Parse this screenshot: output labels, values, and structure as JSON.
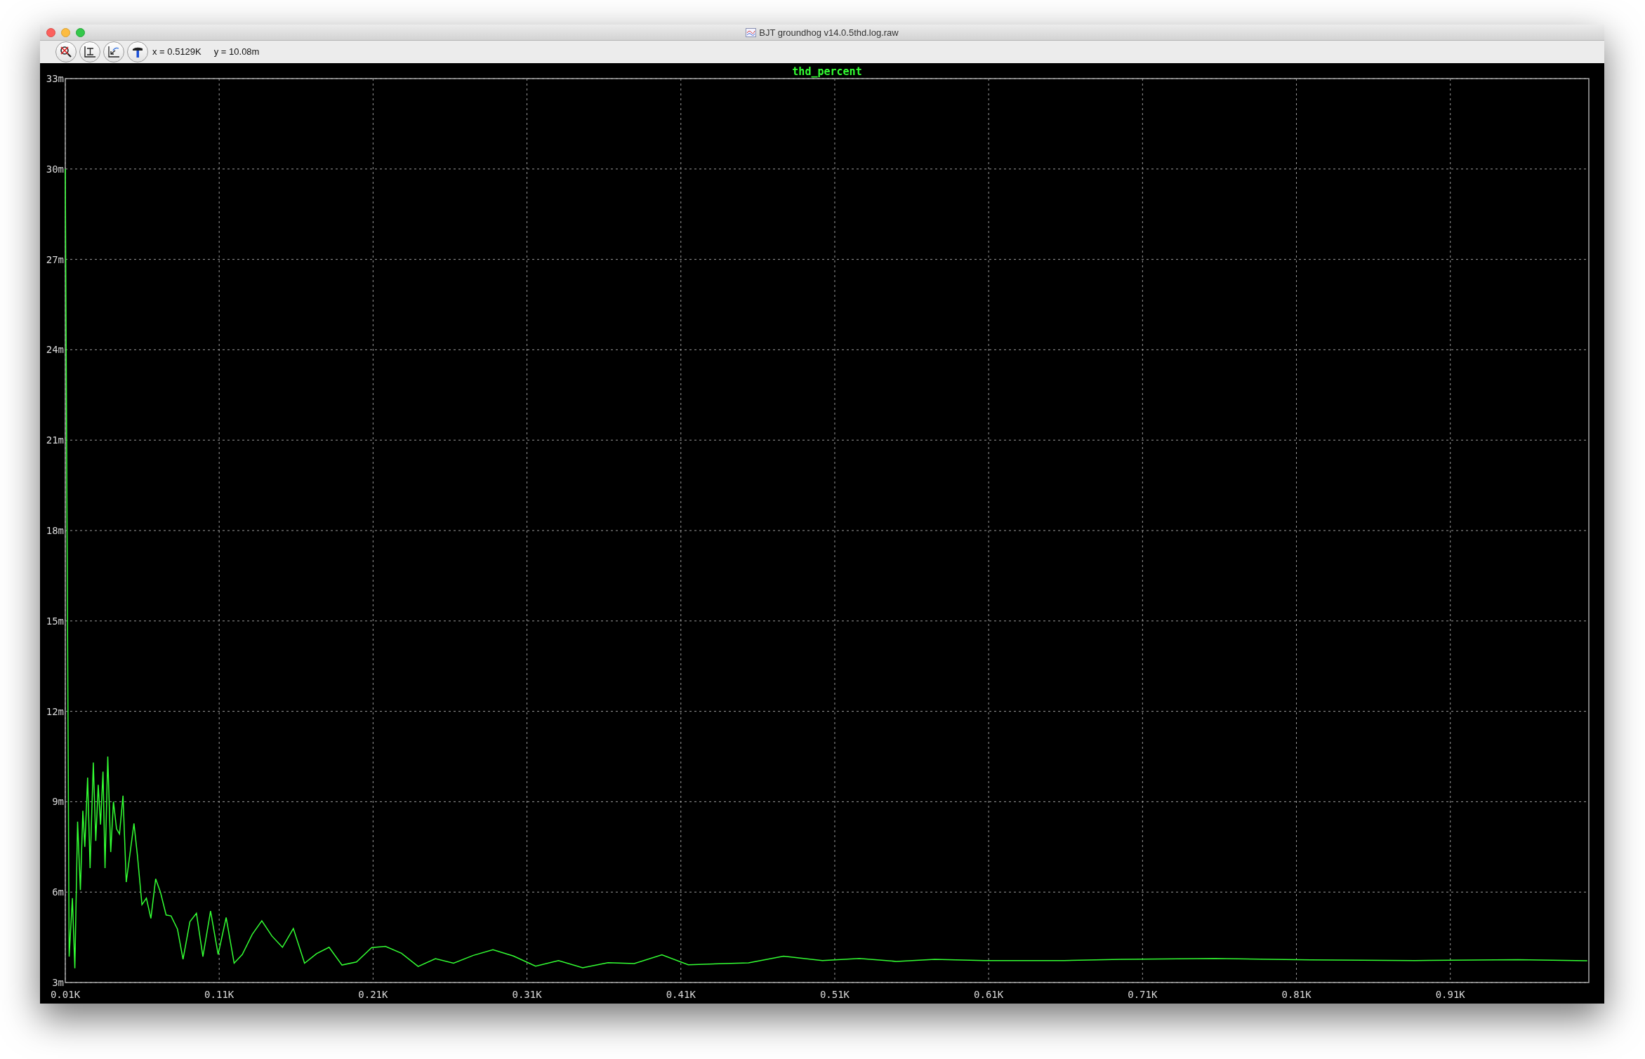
{
  "window": {
    "title": "BJT groundhog v14.0.5thd.log.raw"
  },
  "toolbar": {
    "cursor_x": "x = 0.5129K",
    "cursor_y": "y = 10.08m"
  },
  "plot": {
    "chart_data": {
      "type": "line",
      "x": [
        10,
        12.5,
        14.6,
        16.2,
        18,
        19.8,
        21.4,
        22.7,
        24.5,
        26.1,
        28.2,
        29.8,
        31.4,
        32.9,
        34.5,
        35.8,
        37.6,
        39.5,
        41.3,
        43.3,
        45.2,
        47.5,
        49.6,
        54.6,
        56.9,
        59.8,
        62.7,
        65.6,
        68.7,
        71.8,
        75.5,
        78.7,
        82.9,
        86.5,
        91,
        95.2,
        99.4,
        104.4,
        109.3,
        114.5,
        119.7,
        125,
        131.5,
        137.7,
        144.3,
        151.1,
        158.2,
        165.5,
        173.3,
        181.4,
        189.8,
        199.2,
        209.1,
        218.1,
        228.5,
        239.3,
        250.5,
        262.3,
        275.1,
        287.9,
        301.2,
        315.6,
        330.5,
        346.2,
        362.7,
        379.7,
        397.7,
        414.8,
        454,
        476.7,
        502,
        526,
        550,
        575,
        607,
        659,
        696,
        757,
        819,
        887,
        954,
        999
      ],
      "series": [
        {
          "name": "thd_percent",
          "color": "#33ff33",
          "values": [
            30,
            3.86,
            5.8,
            3.47,
            8.34,
            6.07,
            8.7,
            7.5,
            9.8,
            6.8,
            10.3,
            7.7,
            9.56,
            8.24,
            10,
            6.8,
            10.5,
            7.33,
            9.0,
            8.1,
            7.93,
            9.2,
            6.33,
            8.28,
            7.2,
            5.58,
            5.8,
            5.13,
            6.44,
            6.0,
            5.24,
            5.21,
            4.77,
            3.77,
            5.02,
            5.3,
            3.86,
            5.37,
            3.93,
            5.16,
            3.64,
            3.93,
            4.6,
            5.05,
            4.54,
            4.17,
            4.79,
            3.64,
            3.96,
            4.17,
            3.58,
            3.68,
            4.16,
            4.2,
            3.97,
            3.53,
            3.79,
            3.64,
            3.9,
            4.09,
            3.88,
            3.54,
            3.73,
            3.49,
            3.66,
            3.63,
            3.92,
            3.59,
            3.65,
            3.87,
            3.73,
            3.8,
            3.7,
            3.77,
            3.73,
            3.73,
            3.77,
            3.8,
            3.75,
            3.73,
            3.76,
            3.72
          ]
        }
      ],
      "grid": true,
      "xlim": [
        10,
        1000
      ],
      "ylim": [
        3,
        33
      ],
      "xticks": [
        {
          "value": 10,
          "label": "0.01K"
        },
        {
          "value": 110,
          "label": "0.11K"
        },
        {
          "value": 210,
          "label": "0.21K"
        },
        {
          "value": 310,
          "label": "0.31K"
        },
        {
          "value": 410,
          "label": "0.41K"
        },
        {
          "value": 510,
          "label": "0.51K"
        },
        {
          "value": 610,
          "label": "0.61K"
        },
        {
          "value": 710,
          "label": "0.71K"
        },
        {
          "value": 810,
          "label": "0.81K"
        },
        {
          "value": 910,
          "label": "0.91K"
        }
      ],
      "yticks": [
        {
          "value": 3,
          "label": "3m"
        },
        {
          "value": 6,
          "label": "6m"
        },
        {
          "value": 9,
          "label": "9m"
        },
        {
          "value": 12,
          "label": "12m"
        },
        {
          "value": 15,
          "label": "15m"
        },
        {
          "value": 18,
          "label": "18m"
        },
        {
          "value": 21,
          "label": "21m"
        },
        {
          "value": 24,
          "label": "24m"
        },
        {
          "value": 27,
          "label": "27m"
        },
        {
          "value": 30,
          "label": "30m"
        },
        {
          "value": 33,
          "label": "33m"
        }
      ]
    }
  }
}
